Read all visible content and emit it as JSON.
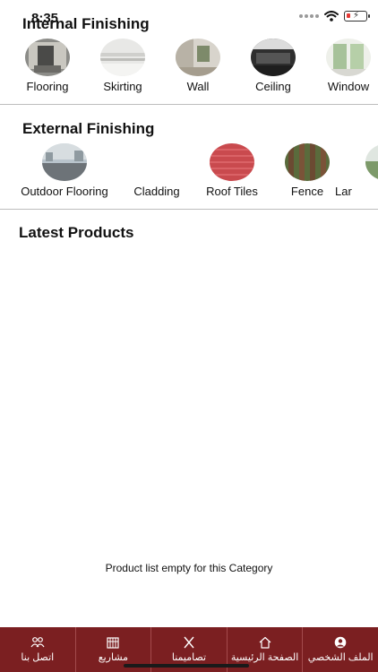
{
  "status_bar": {
    "time": "8:35",
    "icons": [
      "signal-dots-icon",
      "wifi-icon",
      "battery-low-icon"
    ]
  },
  "internal": {
    "title": "Internal Finishing",
    "items": [
      {
        "label": "Flooring",
        "icon": "flooring-image"
      },
      {
        "label": "Skirting",
        "icon": "skirting-image"
      },
      {
        "label": "Wall",
        "icon": "wall-image"
      },
      {
        "label": "Ceiling",
        "icon": "ceiling-image"
      },
      {
        "label": "Window",
        "icon": "window-image"
      }
    ]
  },
  "external": {
    "title": "External Finishing",
    "items": [
      {
        "label": "Outdoor Flooring",
        "icon": "outdoor-flooring-image"
      },
      {
        "label": "Cladding",
        "icon": "cladding-image"
      },
      {
        "label": "Roof Tiles",
        "icon": "roof-tiles-image"
      },
      {
        "label": "Fence",
        "icon": "fence-image"
      },
      {
        "label": "Lar",
        "icon": "landscape-image"
      }
    ]
  },
  "latest": {
    "title": "Latest Products",
    "empty_message": "Product list empty for this Category"
  },
  "bottom_nav": {
    "items": [
      {
        "label": "اتصل بنا",
        "icon": "contact-icon"
      },
      {
        "label": "مشاريع",
        "icon": "projects-icon"
      },
      {
        "label": "تصاميمنا",
        "icon": "designs-icon"
      },
      {
        "label": "الصفحة الرئيسية",
        "icon": "home-icon"
      },
      {
        "label": "الملف الشخصي",
        "icon": "profile-icon"
      }
    ]
  },
  "colors": {
    "nav_background": "#7b1f21",
    "divider": "#bdbdbd",
    "battery_low": "#e53935"
  }
}
